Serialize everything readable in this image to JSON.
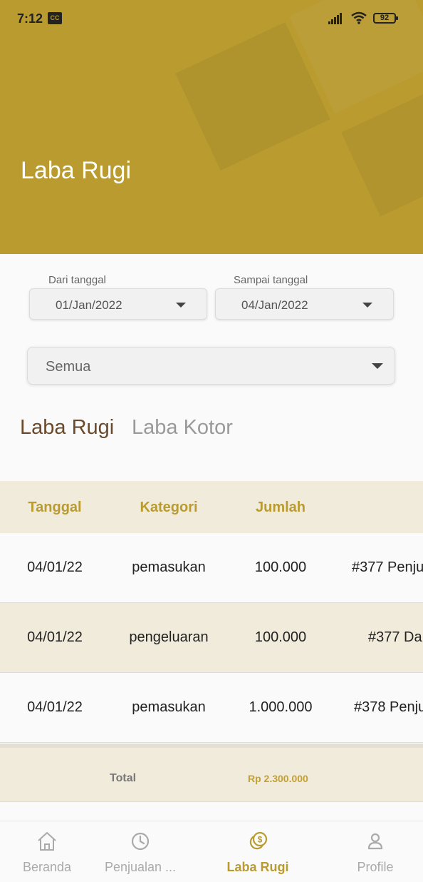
{
  "status_bar": {
    "time": "7:12",
    "cc": "CC",
    "battery": "92"
  },
  "header": {
    "title": "Laba Rugi"
  },
  "filters": {
    "from_label": "Dari tanggal",
    "from_value": "01/Jan/2022",
    "to_label": "Sampai tanggal",
    "to_value": "04/Jan/2022",
    "category_value": "Semua"
  },
  "tabs": {
    "active": "Laba Rugi",
    "inactive": "Laba Kotor"
  },
  "table": {
    "headers": [
      "Tanggal",
      "Kategori",
      "Jumlah"
    ],
    "rows": [
      {
        "tanggal": "04/01/22",
        "kategori": "pemasukan",
        "jumlah": "100.000",
        "keterangan": "#377 Penju"
      },
      {
        "tanggal": "04/01/22",
        "kategori": "pengeluaran",
        "jumlah": "100.000",
        "keterangan": "#377 Da"
      },
      {
        "tanggal": "04/01/22",
        "kategori": "pemasukan",
        "jumlah": "1.000.000",
        "keterangan": "#378 Penju"
      }
    ]
  },
  "total": {
    "label": "Total",
    "value": "Rp 2.300.000"
  },
  "nav": [
    {
      "label": "Beranda",
      "icon": "home-icon"
    },
    {
      "label": "Penjualan ...",
      "icon": "clock-icon"
    },
    {
      "label": "Laba Rugi",
      "icon": "coins-icon"
    },
    {
      "label": "Profile",
      "icon": "person-icon"
    }
  ],
  "colors": {
    "accent": "#b99b30",
    "row_alt": "#f1ebdb",
    "tab_active": "#6a4a2a"
  }
}
